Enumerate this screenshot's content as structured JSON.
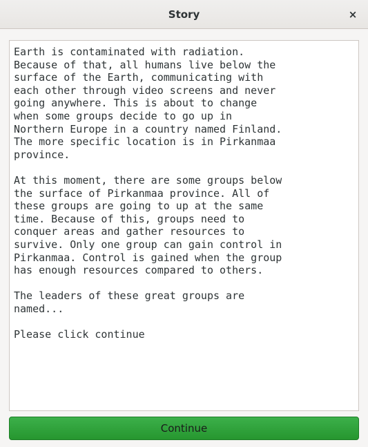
{
  "window": {
    "title": "Story",
    "close_symbol": "×"
  },
  "story": {
    "text": "Earth is contaminated with radiation.\nBecause of that, all humans live below the\nsurface of the Earth, communicating with\neach other through video screens and never\ngoing anywhere. This is about to change\nwhen some groups decide to go up in\nNorthern Europe in a country named Finland.\nThe more specific location is in Pirkanmaa\nprovince.\n\nAt this moment, there are some groups below\nthe surface of Pirkanmaa province. All of\nthese groups are going to up at the same\ntime. Because of this, groups need to\nconquer areas and gather resources to\nsurvive. Only one group can gain control in\nPirkanmaa. Control is gained when the group\nhas enough resources compared to others.\n\nThe leaders of these great groups are\nnamed...\n\nPlease click continue"
  },
  "actions": {
    "continue_label": "Continue"
  },
  "colors": {
    "button_green": "#2ea43a",
    "text": "#2e3436",
    "window_bg": "#f6f5f4"
  }
}
